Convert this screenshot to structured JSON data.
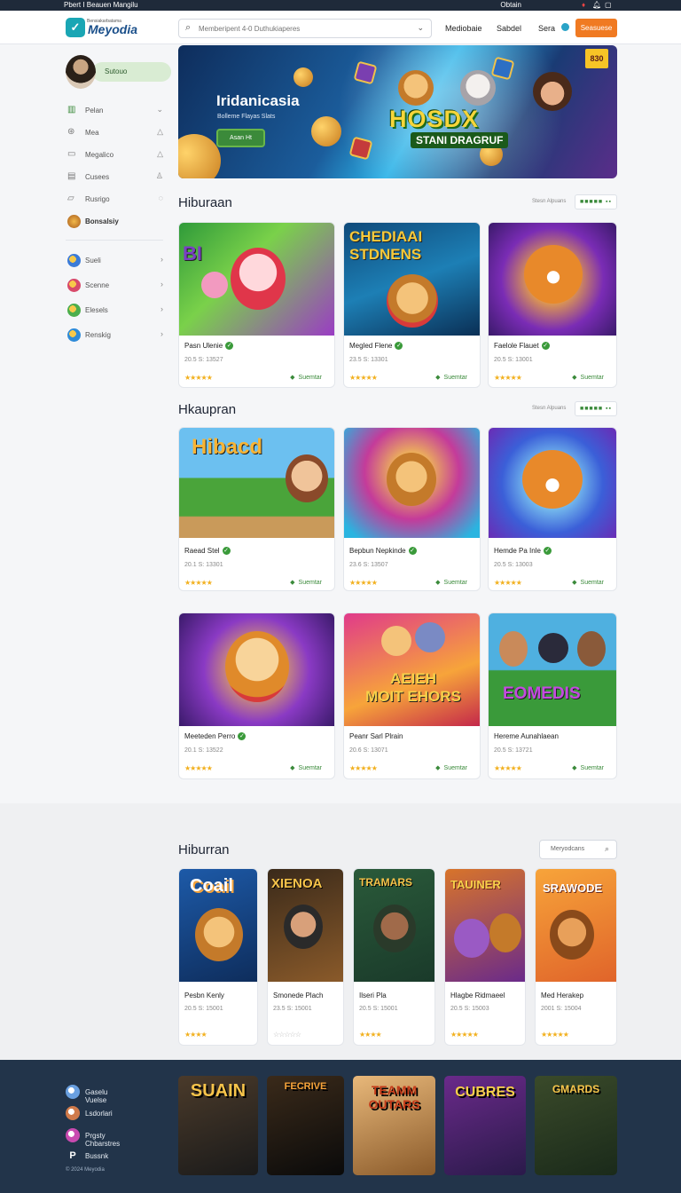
{
  "topstrip": {
    "left": "Pbert I Beauen  Mangilu",
    "right": "Obtain"
  },
  "header": {
    "logo_text": "Meyodia",
    "logo_sub": "Bensiakarbatama",
    "search_placeholder": "Memberipent 4-0 Duthukiaperes",
    "nav": [
      "Mediobaie",
      "Sabdel",
      "Sera"
    ],
    "cta": "Seasuese"
  },
  "sidebar": {
    "profile_label": "Sutouo",
    "items": [
      {
        "icon": "bar-chart-icon",
        "label": "Pelan",
        "right": "chevron-down-icon"
      },
      {
        "icon": "gamepad-icon",
        "label": "Mea",
        "right": "bell-icon"
      },
      {
        "icon": "message-icon",
        "label": "Megalico",
        "right": "bell-icon"
      },
      {
        "icon": "document-icon",
        "label": "Cusees",
        "right": "user-icon"
      },
      {
        "icon": "folder-icon",
        "label": "Rusrigo",
        "right": "shield-icon"
      },
      {
        "icon": "trophy-icon",
        "label": "Bonsalsiy",
        "bold": true
      }
    ],
    "channels": [
      {
        "label": "Sueli",
        "color": "#3b7bd8"
      },
      {
        "label": "Scenne",
        "color": "#d84a6a"
      },
      {
        "label": "Elesels",
        "color": "#4cae4c"
      },
      {
        "label": "Renskig",
        "color": "#2e8bd8"
      }
    ]
  },
  "hero": {
    "title": "Iridanicasia",
    "subtitle": "Bolleme Flayas Slats",
    "button": "Asan Ht",
    "big_text": "HOSDX",
    "big_sub": "STANI DRAGRUF",
    "badge": "830"
  },
  "sections": [
    {
      "title": "Hiburaan",
      "more": "Stesn Alpuans",
      "button": "■■■■■ ▪▪",
      "cards": [
        {
          "name": "Pasn Ulenie",
          "date": "20.5 S: 13527",
          "stars": "★★★★★",
          "tag": "Suemtar"
        },
        {
          "name": "Megled Flene",
          "date": "23.5 S: 13301",
          "stars": "★★★★★",
          "tag": "Suemtar"
        },
        {
          "name": "Faelole Flauet",
          "date": "20.5 S: 13001",
          "stars": "★★★★★",
          "tag": "Suemtar"
        }
      ]
    },
    {
      "title": "Hkaupran",
      "more": "Stesn Alpuans",
      "button": "■■■■■ ▪▪",
      "cards": [
        {
          "name": "Raead Stel",
          "date": "20.1 S: 13301",
          "stars": "★★★★★",
          "tag": "Suemtar"
        },
        {
          "name": "Bepbun  Nepkinde",
          "date": "23.6 S: 13507",
          "stars": "★★★★★",
          "tag": "Suemtar"
        },
        {
          "name": "Hemde Pa Inle",
          "date": "20.5 S: 13003",
          "stars": "★★★★★",
          "tag": "Suemtar"
        }
      ]
    },
    {
      "cards": [
        {
          "name": "Meeteden Perro",
          "date": "20.1 S: 13522",
          "stars": "★★★★★",
          "tag": "Suemtar"
        },
        {
          "name": "Peanr Sarl Plrain",
          "date": "20.6 S: 13071",
          "stars": "★★★★★",
          "tag": "Suemtar"
        },
        {
          "name": "Hereme Aunahlaean",
          "date": "20.5 S: 13721",
          "stars": "★★★★★",
          "tag": "Suemtar"
        }
      ]
    }
  ],
  "popular": {
    "title": "Hiburran",
    "search_label": "Meryodcans",
    "cards": [
      {
        "name": "Pesbn Kenly",
        "date": "20.5 S: 15001",
        "stars": "★★★★",
        "art": "Coail"
      },
      {
        "name": "Smonede Plach",
        "date": "23.5 S: 15001",
        "stars": "☆☆☆☆☆",
        "art": "XIENOA"
      },
      {
        "name": "Ilseri Pla",
        "date": "20.5 S: 15001",
        "stars": "★★★★",
        "art": "TRAMARS"
      },
      {
        "name": "Hlagbe Ridmaeel",
        "date": "20.5 S: 15003",
        "stars": "★★★★★",
        "art": "TAUINER"
      },
      {
        "name": "Med Herakep",
        "date": "2001 S: 15004",
        "stars": "★★★★★",
        "art": "SRAWODE"
      }
    ]
  },
  "footer": {
    "items": [
      {
        "label": "Gaselu Vuelse",
        "color": "#6aa0e0"
      },
      {
        "label": "Lsdorlari",
        "color": "#d07a4a"
      },
      {
        "label": "Prgsty Chbarstres",
        "color": "#c94ab0"
      },
      {
        "label": "Bussnk",
        "color": "#ffffff"
      }
    ],
    "copyright": "© 2024 Meyodia",
    "tiles": [
      "SUAIN",
      "FECRIVE",
      "TEAMM OUTARS",
      "CUBRES",
      "GMARDS"
    ]
  }
}
